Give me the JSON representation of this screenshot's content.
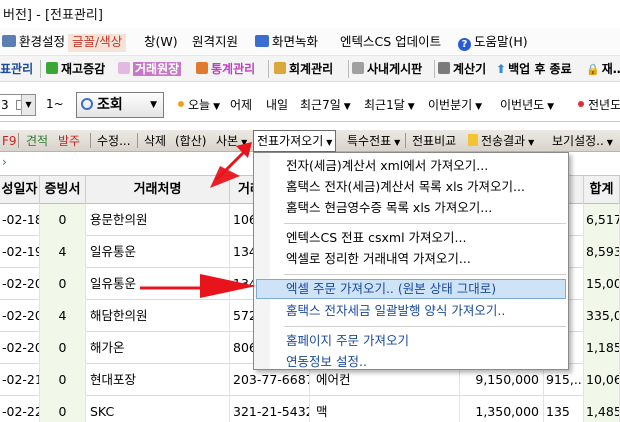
{
  "window": {
    "title": "버전] - [전표관리]"
  },
  "menubar": {
    "items": [
      {
        "label": "환경설정",
        "icon": "settings-icon",
        "color": "#5b7fb3"
      },
      {
        "label": "글꼴/색상",
        "icon": "font-color-icon",
        "color": "#c0392b"
      },
      {
        "label": "창(W)"
      },
      {
        "label": "원격지원"
      },
      {
        "label": "화면녹화",
        "icon": "monitor-icon",
        "color": "#3a6fd0"
      },
      {
        "label": "엔텍스CS 업데이트"
      },
      {
        "label": "도움말(H)",
        "icon": "help-icon",
        "glyph": "?"
      }
    ]
  },
  "toolbar": {
    "items": [
      {
        "label": "표관리",
        "color": "#1a4aa0"
      },
      {
        "label": "재고증감",
        "color": "#000000",
        "icon_color": "#3aa636"
      },
      {
        "label": "거래원장",
        "color": "#ffffff",
        "bg": "#c878c8",
        "icon_color": "#e1b9e1"
      },
      {
        "label": "통계관리",
        "color": "#c040c0",
        "icon_color": "#e07a30"
      },
      {
        "label": "회계관리",
        "color": "#000000",
        "icon_color": "#d8a83a"
      },
      {
        "label": "사내게시판",
        "color": "#000000",
        "icon_color": "#a0a0a0"
      },
      {
        "label": "계산기",
        "color": "#000000",
        "icon_color": "#7a7a7a"
      },
      {
        "label": "백업 후 종료",
        "color": "#000000",
        "icon_color": "#3a8ad0",
        "glyph": "⬆"
      },
      {
        "label": "재…",
        "color": "#000000",
        "icon_color": "#3a6fd0",
        "glyph": "🔒"
      }
    ]
  },
  "filterbar": {
    "date_combo": "3",
    "range_combo": "1~",
    "search_label": "조회",
    "periods": [
      {
        "label": "오늘",
        "dot": "#f0a020"
      },
      {
        "label": "어제"
      },
      {
        "label": "내일"
      },
      {
        "label": "최근7일"
      },
      {
        "label": "최근1달"
      },
      {
        "label": "이번분기"
      },
      {
        "label": "이번년도"
      },
      {
        "label": "전년도",
        "dot": "#e03030"
      }
    ]
  },
  "cmdbar": {
    "items": [
      {
        "label": "F9",
        "color": "#cc2020"
      },
      {
        "label": "견적",
        "color": "#2a7a2a"
      },
      {
        "label": "발주",
        "color": "#cc2020"
      },
      {
        "label": "수정..."
      },
      {
        "label": "삭제"
      },
      {
        "label": "(합산)"
      },
      {
        "label": "사본",
        "arrow": true
      },
      {
        "label": "전표가져오기",
        "arrow": true
      },
      {
        "label": "특수전표",
        "arrow": true
      },
      {
        "label": "전표비교"
      },
      {
        "label": "전송결과",
        "arrow": true
      },
      {
        "label": "보기설정..",
        "arrow": true
      }
    ]
  },
  "grid": {
    "columns": [
      "성일자",
      "증빙서",
      "거래처명",
      "거래",
      "",
      "",
      "합계"
    ],
    "rows": [
      {
        "date": "-02-18",
        "proof": "0",
        "client": "용문한의원",
        "biz": "106",
        "amount": "",
        "tax": "",
        "total": "6,517,."
      },
      {
        "date": "-02-19",
        "proof": "4",
        "client": "일유통운",
        "biz": "134",
        "amount": "",
        "tax": "",
        "total": "8,593,."
      },
      {
        "date": "-02-20",
        "proof": "0",
        "client": "일유통운",
        "biz": "134",
        "amount": "",
        "tax": "",
        "total": "15,00,."
      },
      {
        "date": "-02-20",
        "proof": "4",
        "client": "해담한의원",
        "biz": "572",
        "amount": "",
        "tax": "55",
        "total": "335,00"
      },
      {
        "date": "-02-20",
        "proof": "0",
        "client": "해가온",
        "biz": "806",
        "amount": "",
        "tax": "0",
        "total": "1,185,."
      },
      {
        "date": "-02-21",
        "proof": "0",
        "client": "현대포장",
        "biz": "203-77-66879",
        "item": "에어컨",
        "amount": "9,150,000",
        "tax": "915,...",
        "total": "10,06,."
      },
      {
        "date": "-02-22",
        "proof": "0",
        "client": "SKC",
        "biz": "321-21-54321",
        "item": "맥",
        "amount": "1,350,000",
        "tax": "135",
        "total": "1,485,."
      }
    ]
  },
  "dropdown": {
    "items": [
      {
        "label": "전자(세금)계산서 xml에서 가져오기..."
      },
      {
        "label": "홈택스 전자(세금)계산서 목록 xls 가져오기..."
      },
      {
        "label": "홈택스 현금영수증 목록 xls 가져오기..."
      },
      {
        "separator": true
      },
      {
        "label": "엔텍스CS 전표 csxml 가져오기..."
      },
      {
        "label": "엑셀로 정리한 거래내역 가져오기..."
      },
      {
        "separator": true
      },
      {
        "label": "엑셀 주문 가져오기.. (원본 상태 그대로)",
        "highlight": true,
        "blue": true
      },
      {
        "label": "홈택스 전자세금 일괄발행 양식 가져오기..",
        "blue": true
      },
      {
        "separator": true
      },
      {
        "label": "홈페이지 주문 가져오기",
        "blue": true
      },
      {
        "label": "연동정보 설정..",
        "blue": true
      }
    ]
  },
  "colors": {
    "arrow": "#e8141c",
    "highlight": "#cfe3f6",
    "cmdbar": "#ded9d1"
  }
}
